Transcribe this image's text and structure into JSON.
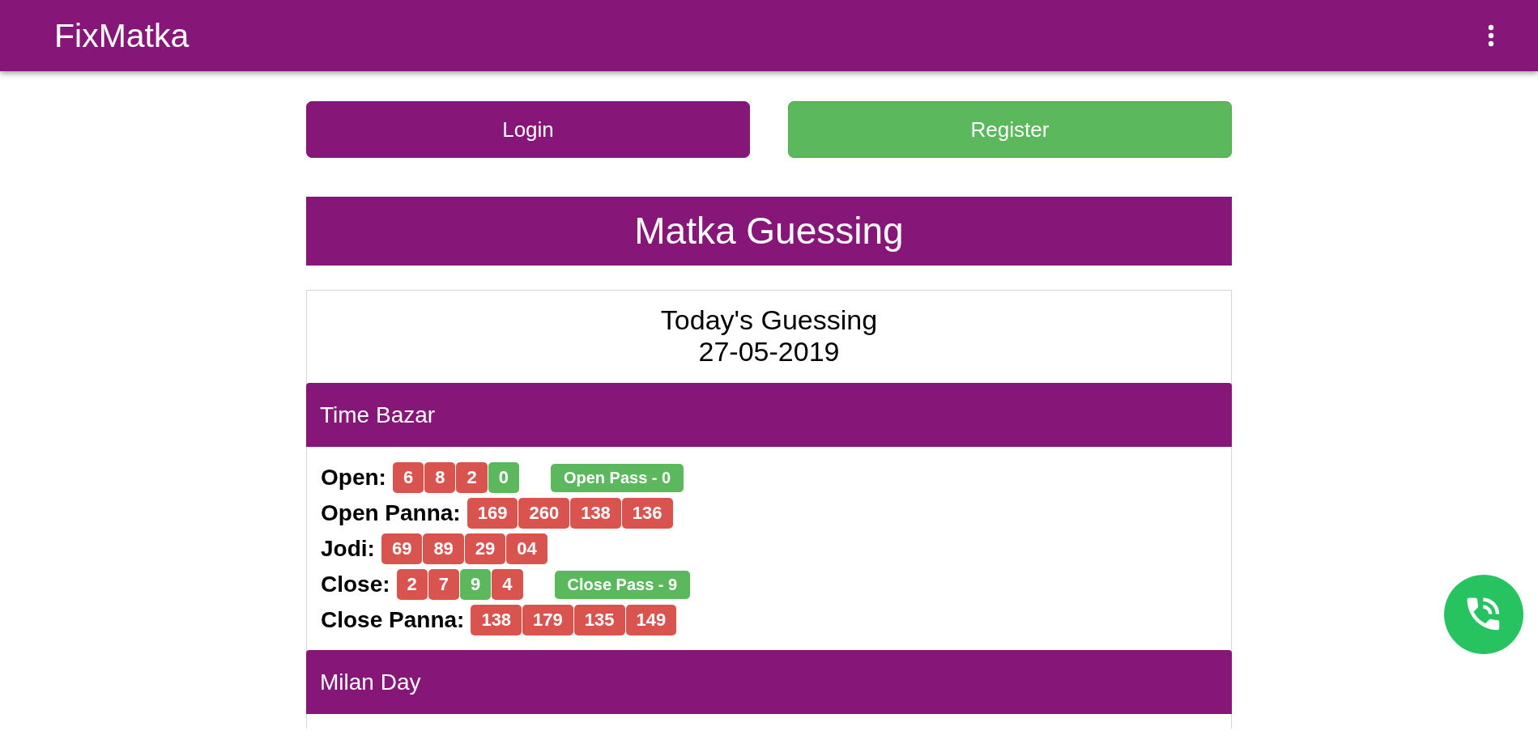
{
  "navbar": {
    "brand": "FixMatka"
  },
  "auth_buttons": [
    {
      "label": "Login",
      "kind": "login"
    },
    {
      "label": "Register",
      "kind": "register"
    }
  ],
  "heading": "Matka Guessing",
  "guessing": {
    "title": "Today's Guessing",
    "date": "27-05-2019",
    "markets": [
      {
        "name": "Time Bazar",
        "rows": [
          {
            "label": "Open:",
            "numbers": [
              {
                "value": "6",
                "hit": false
              },
              {
                "value": "8",
                "hit": false
              },
              {
                "value": "2",
                "hit": false
              },
              {
                "value": "0",
                "hit": true
              }
            ],
            "pass": "Open Pass - 0"
          },
          {
            "label": "Open Panna:",
            "numbers": [
              {
                "value": "169",
                "hit": false
              },
              {
                "value": "260",
                "hit": false
              },
              {
                "value": "138",
                "hit": false
              },
              {
                "value": "136",
                "hit": false
              }
            ]
          },
          {
            "label": "Jodi:",
            "numbers": [
              {
                "value": "69",
                "hit": false
              },
              {
                "value": "89",
                "hit": false
              },
              {
                "value": "29",
                "hit": false
              },
              {
                "value": "04",
                "hit": false
              }
            ]
          },
          {
            "label": "Close:",
            "numbers": [
              {
                "value": "2",
                "hit": false
              },
              {
                "value": "7",
                "hit": false
              },
              {
                "value": "9",
                "hit": true
              },
              {
                "value": "4",
                "hit": false
              }
            ],
            "pass": "Close Pass - 9"
          },
          {
            "label": "Close Panna:",
            "numbers": [
              {
                "value": "138",
                "hit": false
              },
              {
                "value": "179",
                "hit": false
              },
              {
                "value": "135",
                "hit": false
              },
              {
                "value": "149",
                "hit": false
              }
            ]
          }
        ]
      },
      {
        "name": "Milan Day"
      }
    ]
  }
}
